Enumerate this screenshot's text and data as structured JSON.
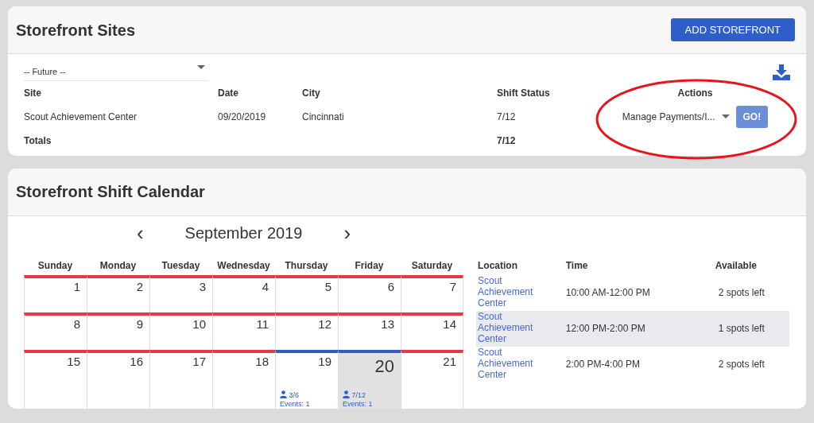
{
  "sites_panel": {
    "title": "Storefront Sites",
    "add_button": "ADD STOREFRONT",
    "filter": {
      "value": "-- Future --"
    },
    "columns": [
      "Site",
      "Date",
      "City",
      "Shift Status",
      "Actions"
    ],
    "rows": [
      {
        "site": "Scout Achievement Center",
        "date": "09/20/2019",
        "city": "Cincinnati",
        "shift_status": "7/12",
        "action": "Manage Payments/I...",
        "go": "GO!"
      }
    ],
    "totals": {
      "label": "Totals",
      "shift_status": "7/12"
    }
  },
  "calendar_panel": {
    "title": "Storefront Shift Calendar",
    "prev": "‹",
    "next": "›",
    "month": "September 2019",
    "weekdays": [
      "Sunday",
      "Monday",
      "Tuesday",
      "Wednesday",
      "Thursday",
      "Friday",
      "Saturday"
    ],
    "weeks": [
      [
        {
          "day": "1",
          "has_events": false,
          "selected": false
        },
        {
          "day": "2",
          "has_events": false,
          "selected": false
        },
        {
          "day": "3",
          "has_events": false,
          "selected": false
        },
        {
          "day": "4",
          "has_events": false,
          "selected": false
        },
        {
          "day": "5",
          "has_events": false,
          "selected": false
        },
        {
          "day": "6",
          "has_events": false,
          "selected": false
        },
        {
          "day": "7",
          "has_events": false,
          "selected": false
        }
      ],
      [
        {
          "day": "8",
          "has_events": false,
          "selected": false
        },
        {
          "day": "9",
          "has_events": false,
          "selected": false
        },
        {
          "day": "10",
          "has_events": false,
          "selected": false
        },
        {
          "day": "11",
          "has_events": false,
          "selected": false
        },
        {
          "day": "12",
          "has_events": false,
          "selected": false
        },
        {
          "day": "13",
          "has_events": false,
          "selected": false
        },
        {
          "day": "14",
          "has_events": false,
          "selected": false
        }
      ],
      [
        {
          "day": "15",
          "has_events": false,
          "selected": false
        },
        {
          "day": "16",
          "has_events": false,
          "selected": false
        },
        {
          "day": "17",
          "has_events": false,
          "selected": false
        },
        {
          "day": "18",
          "has_events": false,
          "selected": false
        },
        {
          "day": "19",
          "has_events": true,
          "selected": false,
          "shifts": "3/6",
          "events": "Events: 1"
        },
        {
          "day": "20",
          "has_events": true,
          "selected": true,
          "shifts": "7/12",
          "events": "Events: 1"
        },
        {
          "day": "21",
          "has_events": false,
          "selected": false
        }
      ]
    ],
    "shift_columns": [
      "Location",
      "Time",
      "Available"
    ],
    "shifts": [
      {
        "location": "Scout Achievement Center",
        "time": "10:00 AM-12:00 PM",
        "available": "2 spots left",
        "selected": false
      },
      {
        "location": "Scout Achievement Center",
        "time": "12:00 PM-2:00 PM",
        "available": "1 spots left",
        "selected": true
      },
      {
        "location": "Scout Achievement Center",
        "time": "2:00 PM-4:00 PM",
        "available": "2 spots left",
        "selected": false
      }
    ]
  },
  "annotations": [
    {
      "kind": "ellipse"
    }
  ]
}
